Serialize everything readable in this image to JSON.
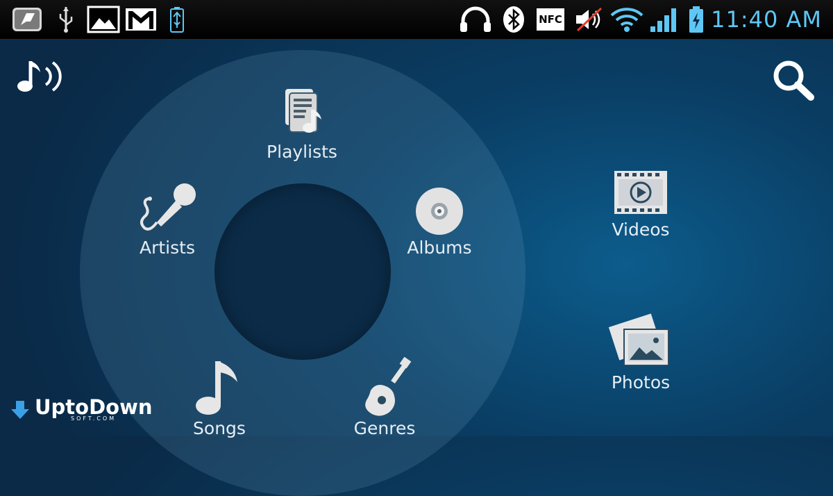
{
  "status_bar": {
    "time": "11:40 AM",
    "nfc_label": "NFC",
    "icons": [
      "app-notification-icon",
      "usb-icon",
      "image-icon",
      "gmail-icon",
      "battery-charging-icon",
      "headphones-icon",
      "bluetooth-icon",
      "nfc-icon",
      "mute-icon",
      "wifi-icon",
      "signal-icon",
      "battery-icon"
    ],
    "accent_color": "#5ec7f4"
  },
  "header": {
    "left_icon": "music-app-icon",
    "right_icon": "search-icon"
  },
  "music_wheel": {
    "items": [
      {
        "label": "Playlists",
        "icon": "playlist-icon"
      },
      {
        "label": "Albums",
        "icon": "album-disc-icon"
      },
      {
        "label": "Artists",
        "icon": "microphone-icon"
      },
      {
        "label": "Songs",
        "icon": "music-note-icon"
      },
      {
        "label": "Genres",
        "icon": "guitar-icon"
      }
    ]
  },
  "side_menu": {
    "items": [
      {
        "label": "Videos",
        "icon": "video-film-icon"
      },
      {
        "label": "Photos",
        "icon": "photos-icon"
      }
    ]
  },
  "watermark": {
    "brand": "UptoDown",
    "sub": "SOFT.COM"
  }
}
